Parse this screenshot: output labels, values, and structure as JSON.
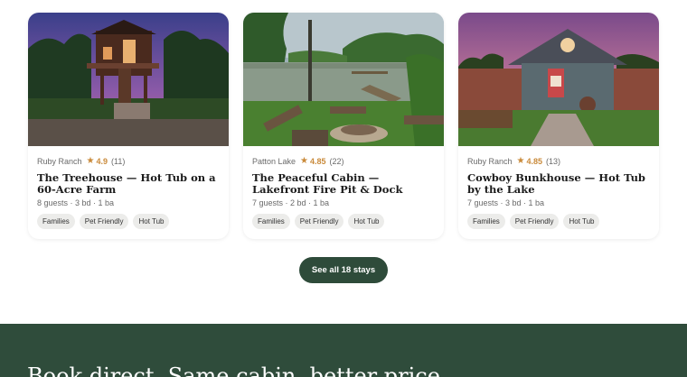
{
  "listings": [
    {
      "location": "Ruby Ranch",
      "rating": "4.9",
      "reviews": "(11)",
      "title": "The Treehouse — Hot Tub on a 60-Acre Farm",
      "specs": "8 guests · 3 bd · 1 ba",
      "tags": [
        "Families",
        "Pet Friendly",
        "Hot Tub"
      ]
    },
    {
      "location": "Patton Lake",
      "rating": "4.85",
      "reviews": "(22)",
      "title": "The Peaceful Cabin — Lakefront Fire Pit & Dock",
      "specs": "7 guests · 2 bd · 1 ba",
      "tags": [
        "Families",
        "Pet Friendly",
        "Hot Tub"
      ]
    },
    {
      "location": "Ruby Ranch",
      "rating": "4.85",
      "reviews": "(13)",
      "title": "Cowboy Bunkhouse — Hot Tub by the Lake",
      "specs": "7 guests · 3 bd · 1 ba",
      "tags": [
        "Families",
        "Pet Friendly",
        "Hot Tub"
      ]
    }
  ],
  "see_all_label": "See all 18 stays",
  "banner": {
    "heading": "Book direct. Same cabin, better price."
  },
  "colors": {
    "brand_green": "#2f4c3b",
    "star": "#c98a3a",
    "tag_bg": "#ececea"
  },
  "icons": {
    "rating": "star-icon"
  }
}
